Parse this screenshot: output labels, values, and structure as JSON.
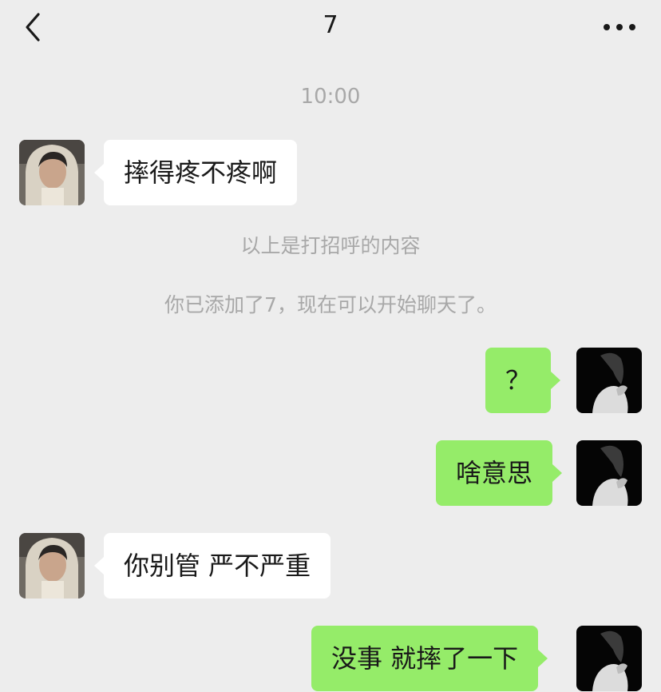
{
  "header": {
    "title": "7",
    "back_icon": "chevron-left-icon",
    "more_icon": "more-dots-icon"
  },
  "chat": {
    "timestamp": "10:00",
    "messages": [
      {
        "side": "left",
        "text": "摔得疼不疼啊"
      },
      {
        "side": "system",
        "text": "以上是打招呼的内容"
      },
      {
        "side": "system",
        "text": "你已添加了7，现在可以开始聊天了。"
      },
      {
        "side": "right",
        "text": "？"
      },
      {
        "side": "right",
        "text": "啥意思"
      },
      {
        "side": "left",
        "text": "你别管  严不严重"
      },
      {
        "side": "right",
        "text": "没事  就摔了一下"
      }
    ]
  },
  "colors": {
    "background": "#ededed",
    "incoming_bubble": "#ffffff",
    "outgoing_bubble": "#95ec69",
    "system_text": "#a8a8a8"
  }
}
